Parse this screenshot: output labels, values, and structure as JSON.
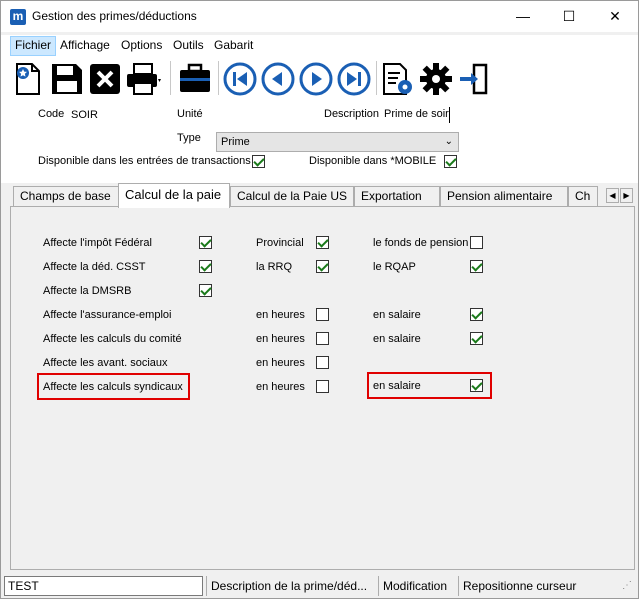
{
  "window": {
    "title": "Gestion des primes/déductions",
    "app_icon": "m",
    "minimize": "—",
    "maximize": "☐",
    "close": "✕"
  },
  "menu": [
    "Fichier",
    "Affichage",
    "Options",
    "Outils",
    "Gabarit"
  ],
  "toolbar": {
    "icons": [
      "new-icon",
      "save-icon",
      "delete-icon",
      "print-icon",
      "briefcase-icon",
      "first-icon",
      "previous-icon",
      "next-icon",
      "last-icon",
      "settings-document-icon",
      "gear-icon",
      "exit-icon"
    ]
  },
  "form": {
    "code_label": "Code",
    "code_value": "SOIR",
    "unite_label": "Unité",
    "description_label": "Description",
    "description_value": "Prime de soir",
    "type_label": "Type",
    "type_value": "Prime",
    "dispo_transactions_label": "Disponible dans les entrées de transactions",
    "dispo_transactions_checked": true,
    "dispo_mobile_label": "Disponible dans *MOBILE",
    "dispo_mobile_checked": true
  },
  "tabs": [
    "Champs de base",
    "Calcul de la paie",
    "Calcul de la Paie US",
    "Exportation",
    "Pension alimentaire",
    "Ch"
  ],
  "active_tab": "Calcul de la paie",
  "panel": {
    "rows": [
      {
        "label": "Affecte l'impôt  Fédéral",
        "checked": true,
        "mid_label": "Provincial",
        "mid_checked": true,
        "right_label": "le fonds de pension",
        "right_checked": false
      },
      {
        "label": "Affecte la déd. CSST",
        "checked": true,
        "mid_label": "la RRQ",
        "mid_checked": true,
        "right_label": "le RQAP",
        "right_checked": true
      },
      {
        "label": "Affecte la DMSRB",
        "checked": true
      },
      {
        "label": "Affecte l'assurance-emploi",
        "mid_label": "en heures",
        "mid_checked": false,
        "right_label": "en salaire",
        "right_checked": true
      },
      {
        "label": "Affecte les calculs du comité",
        "mid_label": "en heures",
        "mid_checked": false,
        "right_label": "en salaire",
        "right_checked": true
      },
      {
        "label": "Affecte les avant. sociaux",
        "mid_label": "en heures",
        "mid_checked": false
      },
      {
        "label": "Affecte les calculs syndicaux",
        "mid_label": "en heures",
        "mid_checked": false,
        "right_label": "en salaire",
        "right_checked": true
      }
    ]
  },
  "status": {
    "input_value": "TEST",
    "cells": [
      "Description de la prime/déd...",
      "Modification",
      "Repositionne curseur"
    ]
  }
}
